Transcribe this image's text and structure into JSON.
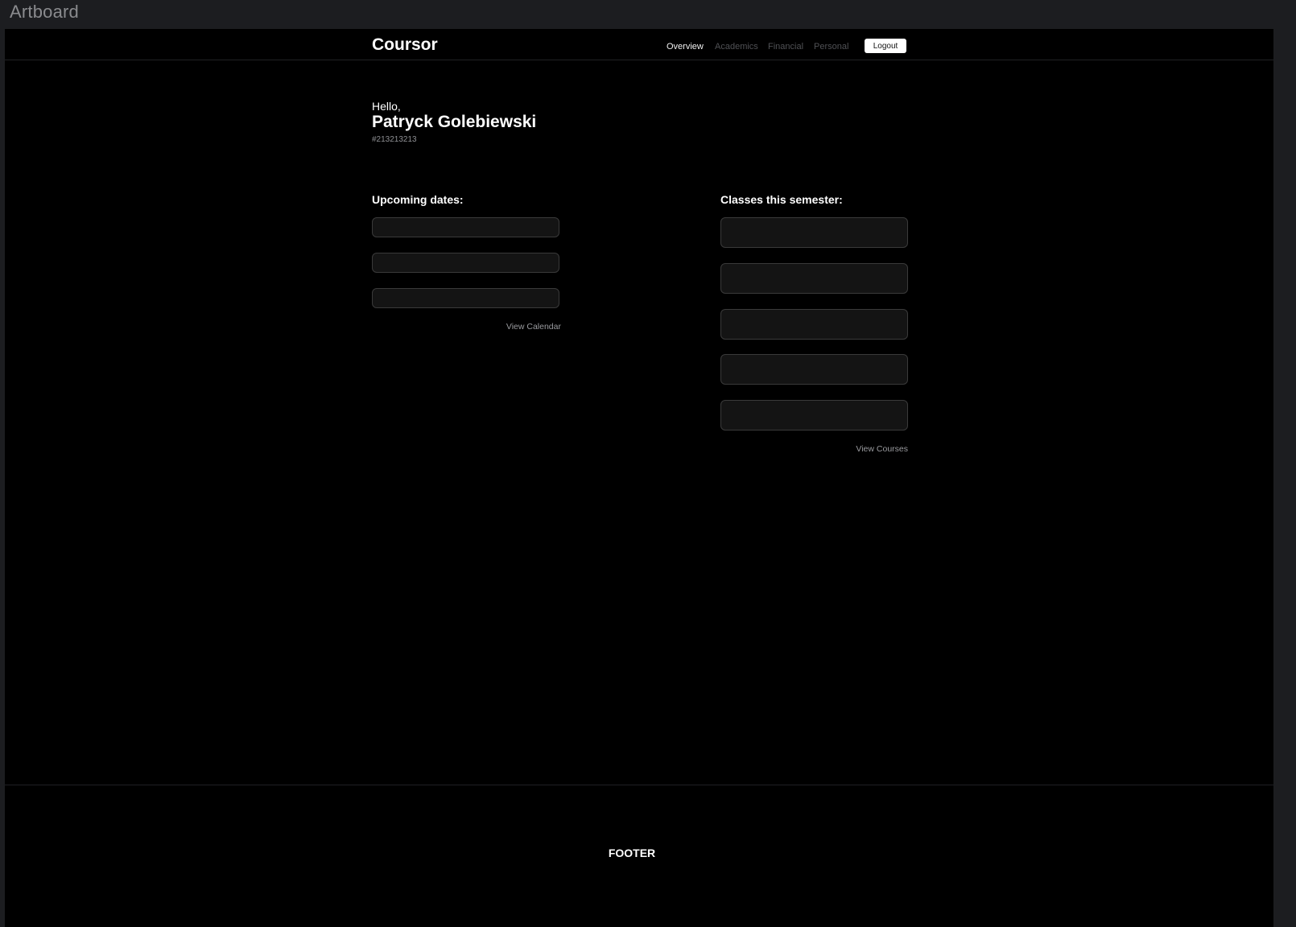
{
  "canvas": {
    "label": "Artboard"
  },
  "header": {
    "brand": "Coursor",
    "nav": [
      {
        "label": "Overview",
        "active": true
      },
      {
        "label": "Academics",
        "active": false
      },
      {
        "label": "Financial",
        "active": false
      },
      {
        "label": "Personal",
        "active": false
      }
    ],
    "logout_label": "Logout"
  },
  "greeting": {
    "hello": "Hello,",
    "name": "Patryck Golebiewski",
    "id": "#213213213"
  },
  "upcoming_dates": {
    "title": "Upcoming dates:",
    "items_count": 3,
    "link_label": "View Calendar"
  },
  "classes": {
    "title": "Classes this semester:",
    "items_count": 5,
    "link_label": "View Courses"
  },
  "footer": {
    "label": "FOOTER"
  },
  "colors": {
    "background": "#000000",
    "canvas": "#1c1d20",
    "card": "#141414",
    "card_border": "#3a3a3a",
    "text_primary": "#ffffff",
    "text_muted": "#505155"
  }
}
